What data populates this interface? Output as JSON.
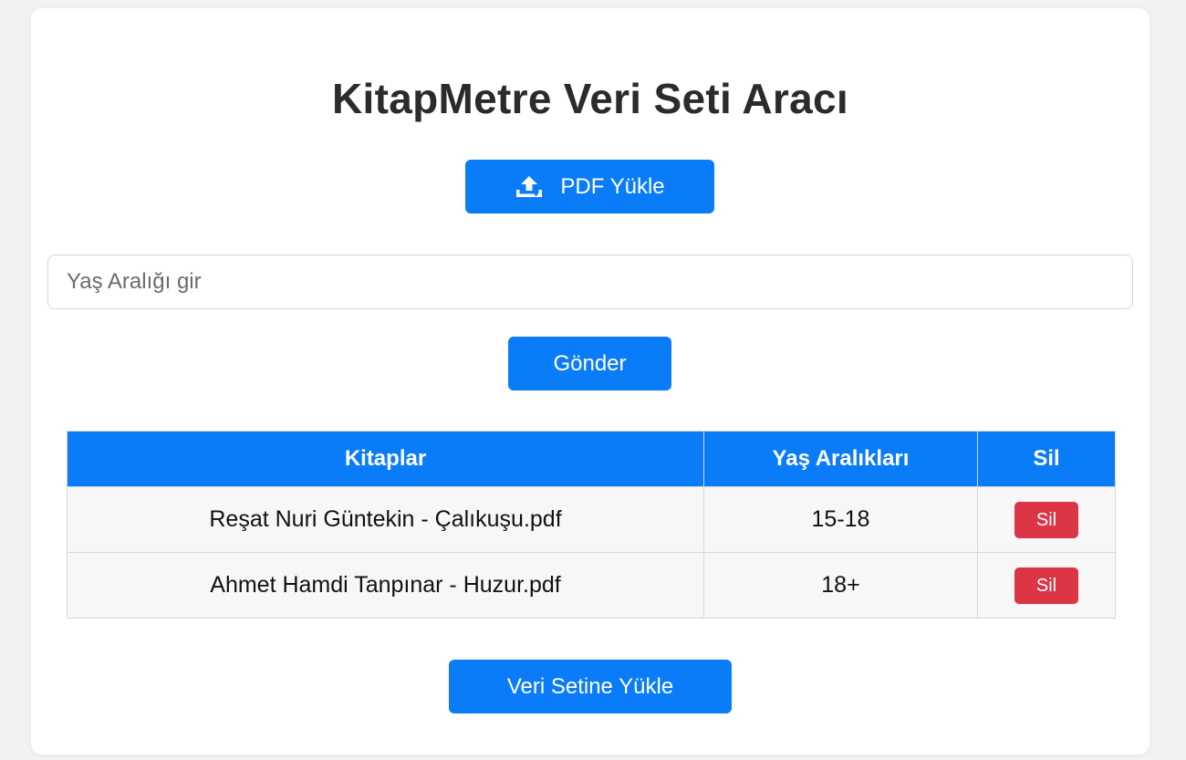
{
  "page": {
    "title": "KitapMetre Veri Seti Aracı"
  },
  "upload": {
    "label": "PDF Yükle",
    "icon": "upload-icon"
  },
  "age_input": {
    "placeholder": "Yaş Aralığı gir",
    "value": ""
  },
  "send_button": {
    "label": "Gönder"
  },
  "table": {
    "headers": [
      "Kitaplar",
      "Yaş Aralıkları",
      "Sil"
    ],
    "rows": [
      {
        "book": "Reşat Nuri Güntekin - Çalıkuşu.pdf",
        "age": "15-18",
        "delete": "Sil"
      },
      {
        "book": "Ahmet Hamdi Tanpınar - Huzur.pdf",
        "age": "18+",
        "delete": "Sil"
      }
    ]
  },
  "dataset_button": {
    "label": "Veri Setine Yükle"
  },
  "colors": {
    "primary": "#0a7cf7",
    "danger": "#dc3545",
    "background": "#f2f2f2",
    "card": "#ffffff"
  }
}
